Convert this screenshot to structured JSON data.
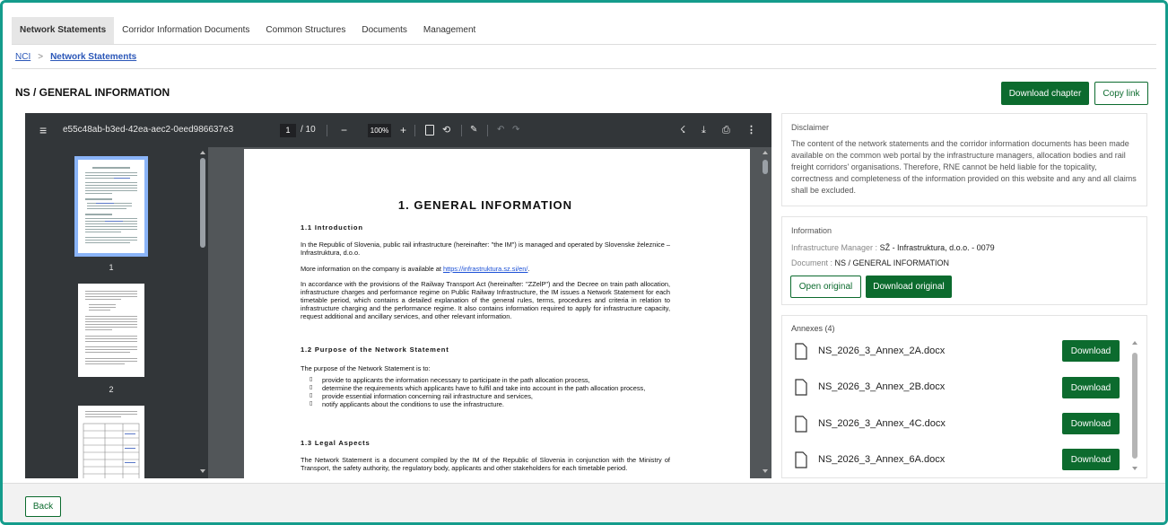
{
  "tabs": [
    {
      "label": "Network Statements",
      "active": true
    },
    {
      "label": "Corridor Information Documents",
      "active": false
    },
    {
      "label": "Common Structures",
      "active": false
    },
    {
      "label": "Documents",
      "active": false
    },
    {
      "label": "Management",
      "active": false
    }
  ],
  "breadcrumb": {
    "root": "NCI",
    "separator": ">",
    "current": "Network Statements"
  },
  "page_title": "NS / GENERAL INFORMATION",
  "actions": {
    "download_chapter": "Download chapter",
    "copy_link": "Copy link"
  },
  "viewer": {
    "filename": "e55c48ab-b3ed-42ea-aec2-0eed986637e3",
    "current_page": "1",
    "total_pages": "/ 10",
    "zoom": "100%",
    "thumb_labels": [
      "1",
      "2"
    ],
    "doc": {
      "title": "1. GENERAL INFORMATION",
      "s1_heading": "1.1 Introduction",
      "s1_p1": "In the Republic of Slovenia, public rail infrastructure (hereinafter: \"the IM\") is managed and operated by Slovenske železnice – Infrastruktura, d.o.o.",
      "s1_p2_prefix": "More information on the company is available at ",
      "s1_p2_link": "https://infrastruktura.sz.si/en/",
      "s1_p2_suffix": ".",
      "s1_p3": "In accordance with the provisions of the Railway Transport Act (hereinafter: \"ZZelP\") and the Decree on train path allocation, infrastructure charges and performance regime on Public Railway Infrastructure, the IM issues a Network Statement for each timetable period, which contains a detailed explanation of the general rules, terms, procedures and criteria in relation to infrastructure charging and the performance regime. It also contains information required to apply for infrastructure capacity, request additional and ancillary services, and other relevant information.",
      "s2_heading": "1.2 Purpose of the Network Statement",
      "s2_p1": "The purpose of the Network Statement is to:",
      "s2_bullets": [
        "provide to applicants the information necessary to participate in the path allocation process,",
        "determine the requirements which applicants have to fulfil and take into account in the path allocation process,",
        "provide essential information concerning rail infrastructure and services,",
        "notify applicants about the conditions to use the infrastructure."
      ],
      "s3_heading": "1.3 Legal Aspects",
      "s3_p1": "The Network Statement is a document compiled by the IM of the Republic of Slovenia in conjunction with the Ministry of Transport, the safety authority, the regulatory body, applicants and other stakeholders for each timetable period."
    }
  },
  "disclaimer": {
    "title": "Disclaimer",
    "text": "The content of the network statements and the corridor information documents has been made available on the common web portal by the infrastructure managers, allocation bodies and rail freight corridors' organisations. Therefore, RNE cannot be held liable for the topicality, correctness and completeness of the information provided on this website and any and all claims shall be excluded."
  },
  "information": {
    "title": "Information",
    "im_label": "Infrastructure Manager :",
    "im_value": "SŽ - Infrastruktura, d.o.o. - 0079",
    "doc_label": "Document :",
    "doc_value": "NS / GENERAL INFORMATION",
    "open_original": "Open original",
    "download_original": "Download original"
  },
  "annexes": {
    "title": "Annexes (4)",
    "download_label": "Download",
    "items": [
      {
        "name": "NS_2026_3_Annex_2A.docx"
      },
      {
        "name": "NS_2026_3_Annex_2B.docx"
      },
      {
        "name": "NS_2026_3_Annex_4C.docx"
      },
      {
        "name": "NS_2026_3_Annex_6A.docx"
      }
    ]
  },
  "footer": {
    "back": "Back"
  },
  "colors": {
    "accent_green": "#0c6b2e",
    "frame_teal": "#149c8c",
    "link_blue": "#2b57b8"
  }
}
